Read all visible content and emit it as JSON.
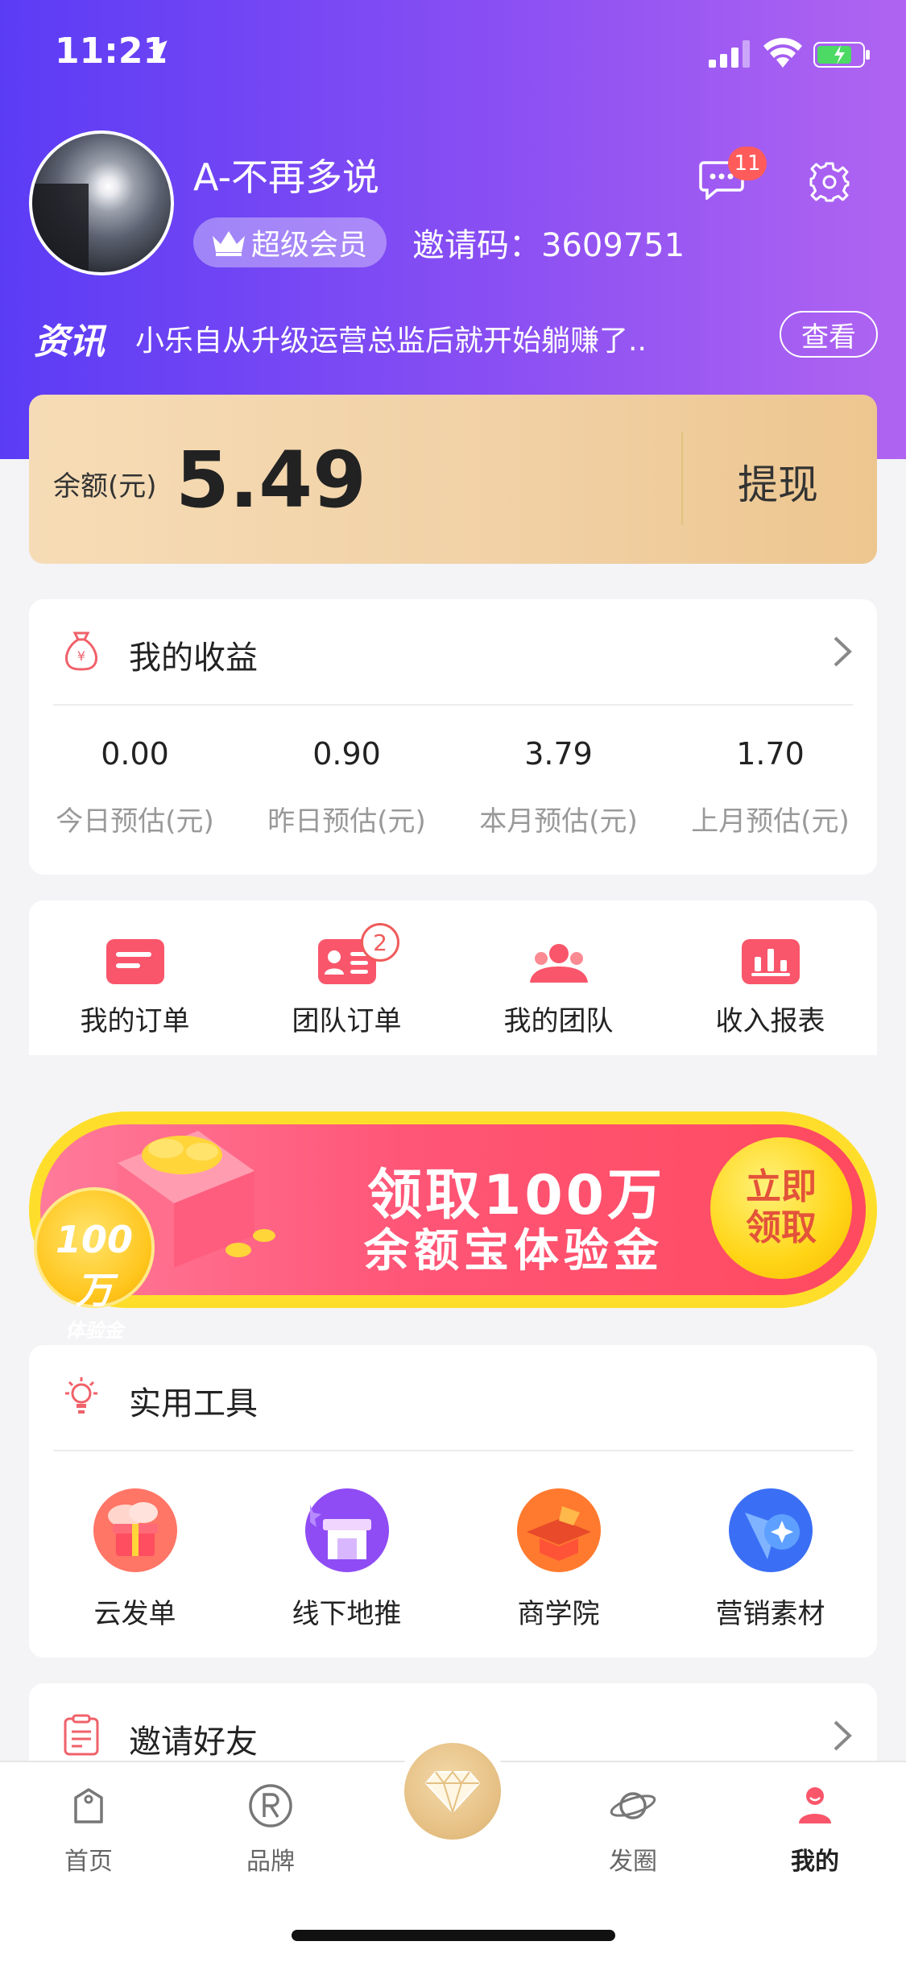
{
  "status_bar": {
    "time": "11:21"
  },
  "profile": {
    "username": "A-不再多说",
    "vip_label": "超级会员",
    "invite_code": "邀请码：3609751",
    "message_count": "11"
  },
  "news": {
    "tag": "资讯",
    "text": "小乐自从升级运营总监后就开始躺赚了..",
    "button": "查看"
  },
  "balance": {
    "label": "余额(元)",
    "value": "5.49",
    "withdraw": "提现"
  },
  "earnings": {
    "title": "我的收益",
    "stats": [
      {
        "value": "0.00",
        "label": "今日预估(元)"
      },
      {
        "value": "0.90",
        "label": "昨日预估(元)"
      },
      {
        "value": "3.79",
        "label": "本月预估(元)"
      },
      {
        "value": "1.70",
        "label": "上月预估(元)"
      }
    ]
  },
  "orders": {
    "items": [
      {
        "label": "我的订单",
        "icon": "order-list-icon"
      },
      {
        "label": "团队订单",
        "icon": "team-order-icon",
        "badge": "2"
      },
      {
        "label": "我的团队",
        "icon": "team-icon"
      },
      {
        "label": "收入报表",
        "icon": "report-chart-icon"
      }
    ]
  },
  "banner": {
    "title": "领取100万",
    "subtitle": "余额宝体验金",
    "button_line1": "立即",
    "button_line2": "领取",
    "coin_line1": "100万",
    "coin_line2": "体验金"
  },
  "tools": {
    "title": "实用工具",
    "items": [
      {
        "label": "云发单",
        "icon": "cloud-gift-icon"
      },
      {
        "label": "线下地推",
        "icon": "storefront-icon"
      },
      {
        "label": "商学院",
        "icon": "graduation-cap-icon"
      },
      {
        "label": "营销素材",
        "icon": "megaphone-icon"
      }
    ]
  },
  "invite": {
    "title": "邀请好友"
  },
  "tab_bar": {
    "tabs": [
      {
        "label": "首页",
        "icon": "shopping-bag-icon"
      },
      {
        "label": "品牌",
        "icon": "brand-r-icon"
      },
      {
        "label": "发圈",
        "icon": "planet-icon"
      },
      {
        "label": "我的",
        "icon": "user-icon",
        "active": true
      }
    ],
    "center_icon": "diamond-icon"
  },
  "colors": {
    "header_start": "#5b3cf5",
    "header_end": "#b064f1",
    "accent_red": "#f05b5b",
    "gold": "#edc68f"
  }
}
